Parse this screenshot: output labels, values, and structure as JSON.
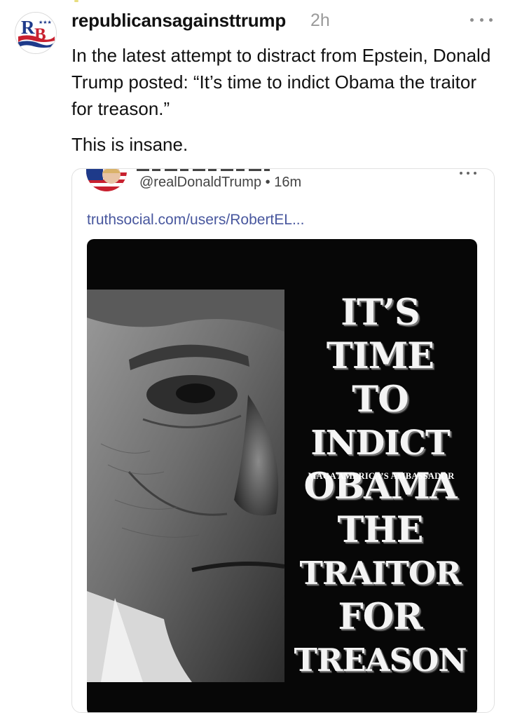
{
  "post": {
    "username": "republicansagainsttrump",
    "timestamp": "2h",
    "text": "In the latest attempt to distract from Epstein, Donald Trump posted: “It’s time to indict Obama the traitor for treason.”",
    "text2": "This is insane.",
    "avatar_letters": "RB",
    "more_icon": "more-horizontal-icon"
  },
  "quoted": {
    "handle": "@realDonaldTrump",
    "separator": "•",
    "time": "16m",
    "link": "truthsocial.com/users/RobertEL...",
    "more_icon": "more-horizontal-icon",
    "image": {
      "lines": [
        "IT’S",
        "TIME",
        "TO",
        "INDICT",
        "OBAMA",
        "THE",
        "TRAITOR",
        "FOR",
        "TREASON"
      ],
      "subtitle": "MAGA AMERICA’S AMBASSADOR"
    }
  },
  "colors": {
    "link": "#48579e",
    "timestamp": "#9a9a9a",
    "poster_bg": "#070707",
    "brand_red": "#c8202f",
    "brand_blue": "#1e3a8a"
  }
}
